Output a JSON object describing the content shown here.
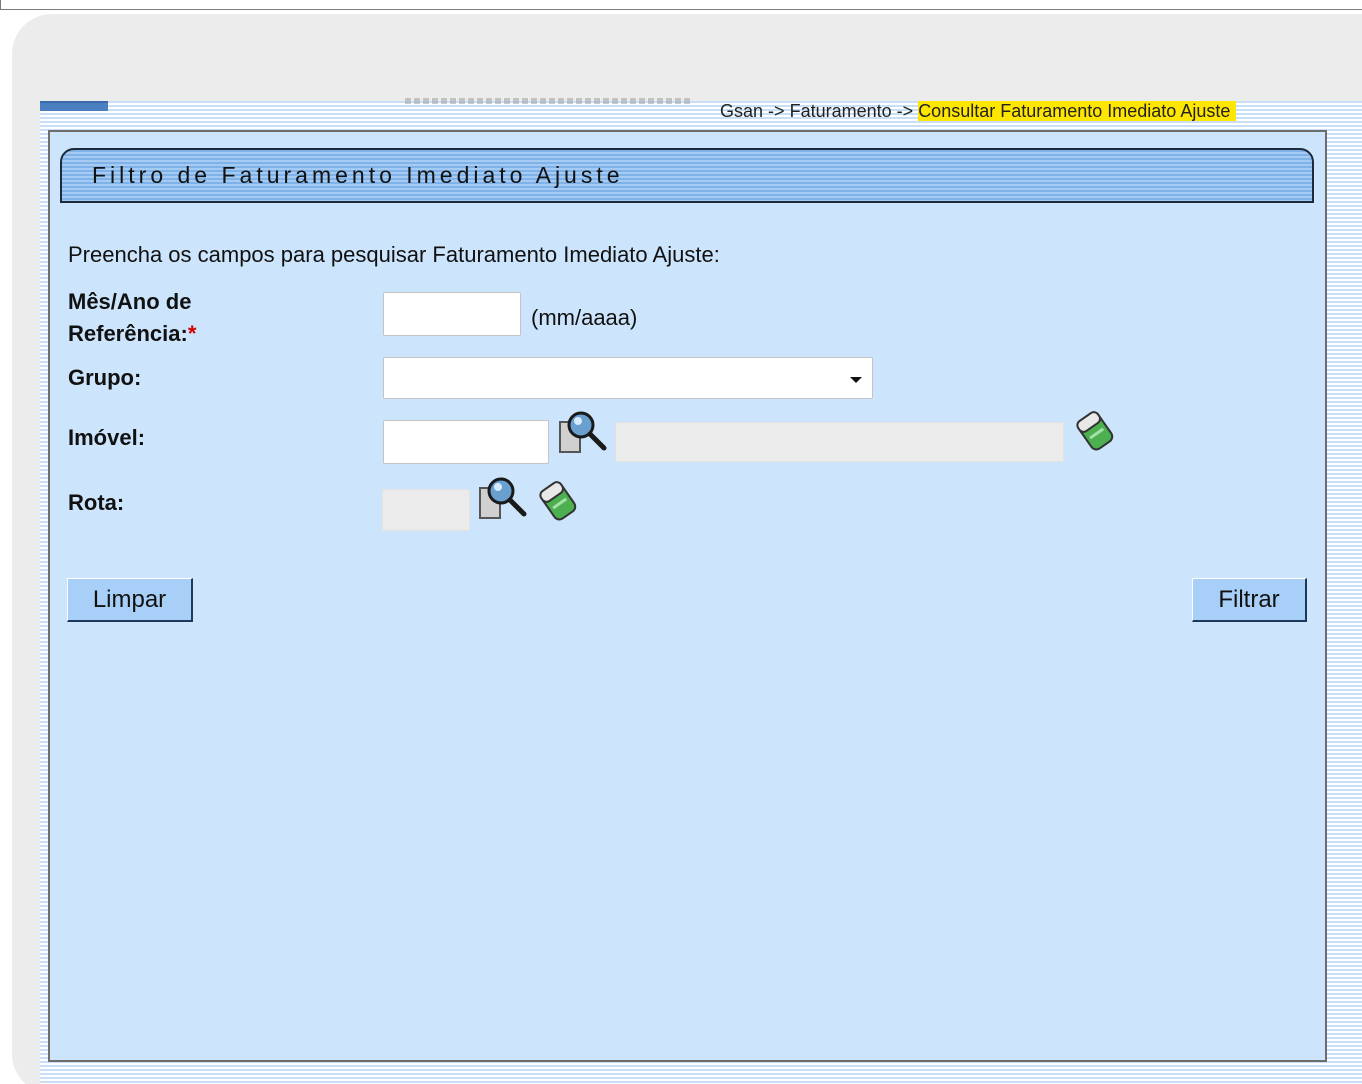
{
  "breadcrumb": {
    "items": [
      "Gsan",
      "Faturamento",
      "Consultar Faturamento Imediato Ajuste"
    ],
    "separator": "->"
  },
  "panel": {
    "title": "Filtro de Faturamento Imediato Ajuste",
    "instruction": "Preencha os campos para pesquisar Faturamento Imediato Ajuste:"
  },
  "form": {
    "mes_ano": {
      "label_line1": "Mês/Ano de",
      "label_line2": "Referência:",
      "required_mark": "*",
      "value": "",
      "hint": "(mm/aaaa)"
    },
    "grupo": {
      "label": "Grupo:",
      "selected": ""
    },
    "imovel": {
      "label": "Imóvel:",
      "value": "",
      "description": ""
    },
    "rota": {
      "label": "Rota:",
      "value": ""
    }
  },
  "buttons": {
    "limpar": "Limpar",
    "filtrar": "Filtrar"
  },
  "icons": {
    "search": "magnifier-search-icon",
    "clear": "eraser-icon"
  },
  "colors": {
    "panel_bg": "#cce5fc",
    "title_bar": "#7fb2e8",
    "highlight": "#ffe600",
    "required": "#d40000"
  }
}
